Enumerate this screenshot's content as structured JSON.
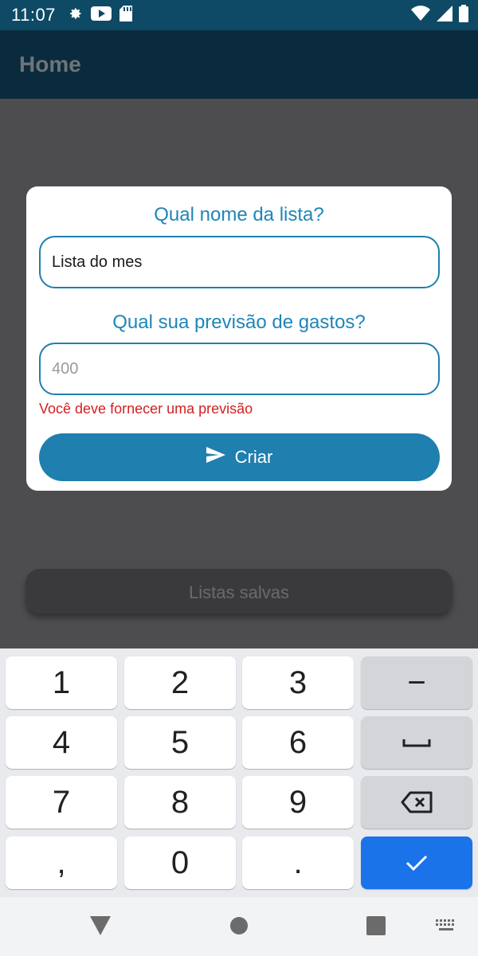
{
  "status_bar": {
    "time": "11:07",
    "icons": [
      "gear-icon",
      "youtube-icon",
      "sd-card-icon",
      "wifi-icon",
      "signal-icon",
      "battery-icon"
    ]
  },
  "app_bar": {
    "title": "Home"
  },
  "background": {
    "saved_lists_label": "Listas salvas"
  },
  "dialog": {
    "name_question": "Qual nome da lista?",
    "name_value": "Lista do mes",
    "budget_question": "Qual sua previsão de gastos?",
    "budget_value": "",
    "budget_placeholder": "400",
    "error_message": "Você deve fornecer uma previsão",
    "create_label": "Criar",
    "create_icon": "send-icon"
  },
  "keyboard": {
    "keys": [
      "1",
      "2",
      "3",
      "−",
      "4",
      "5",
      "6",
      "␣",
      "7",
      "8",
      "9",
      "⌫",
      ",",
      "0",
      ".",
      "✓"
    ],
    "colors": {
      "accent": "#1a73e8",
      "function_key": "#d3d5d9"
    }
  },
  "nav_bar": {
    "icons": [
      "back-icon",
      "home-icon",
      "recents-icon",
      "keyboard-switch-icon"
    ]
  },
  "colors": {
    "primary": "#1f7fae",
    "error": "#d32020",
    "status_bar": "#0e4a66"
  }
}
